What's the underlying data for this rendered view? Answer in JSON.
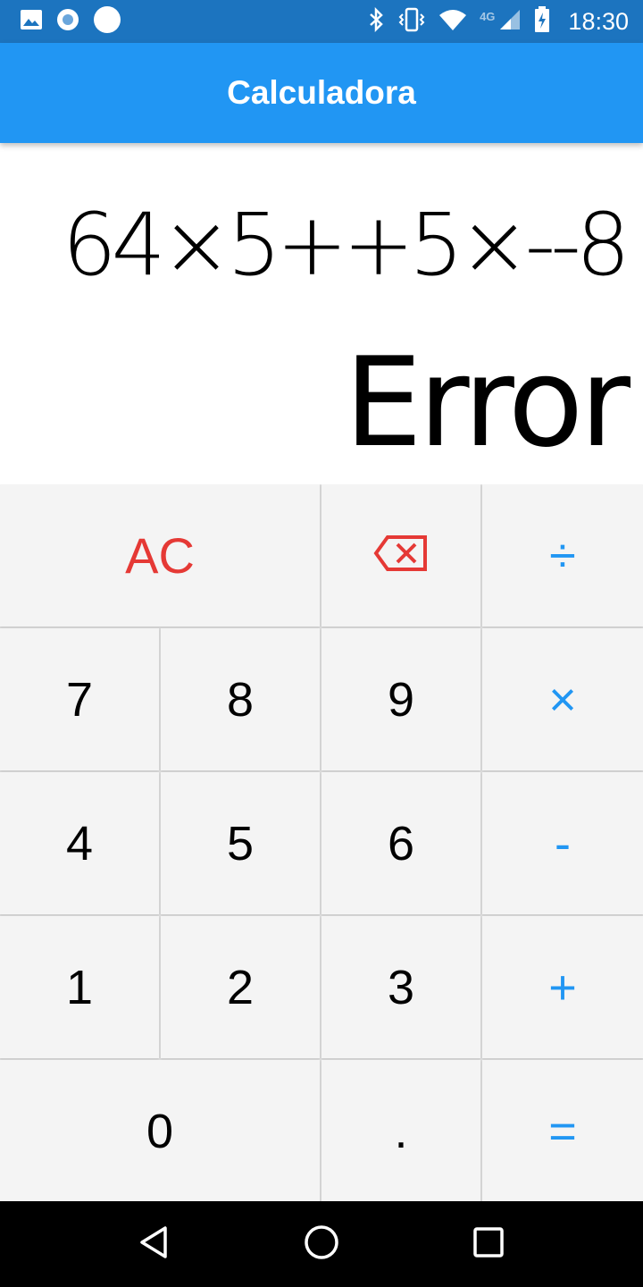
{
  "status_bar": {
    "time": "18:30",
    "network_label": "4G",
    "left_icons": [
      "image-icon",
      "record-icon",
      "circle-icon"
    ],
    "right_icons": [
      "bluetooth-icon",
      "vibrate-icon",
      "wifi-icon",
      "signal-icon",
      "battery-icon"
    ]
  },
  "app_bar": {
    "title": "Calculadora"
  },
  "display": {
    "expression": "64×5++5×--8",
    "result": "Error"
  },
  "keypad": {
    "ac": "AC",
    "divide": "÷",
    "seven": "7",
    "eight": "8",
    "nine": "9",
    "multiply": "×",
    "four": "4",
    "five": "5",
    "six": "6",
    "minus": "-",
    "one": "1",
    "two": "2",
    "three": "3",
    "plus": "+",
    "zero": "0",
    "dot": ".",
    "equals": "="
  },
  "colors": {
    "status_bar": "#1c74bf",
    "app_bar": "#2196f3",
    "operator": "#2196f3",
    "clear": "#e53935",
    "key_bg": "#f4f4f4"
  }
}
